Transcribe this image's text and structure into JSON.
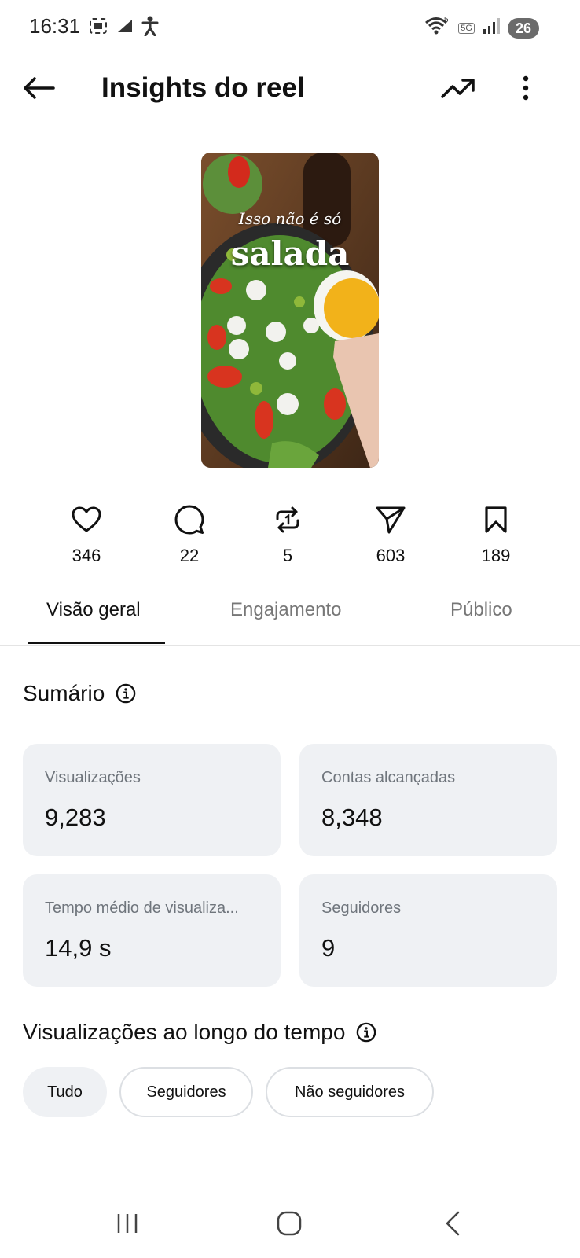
{
  "status_bar": {
    "time": "16:31",
    "battery": "26",
    "network": "5G",
    "wifi_badge": "5"
  },
  "header": {
    "title": "Insights do reel",
    "back_icon": "arrow-left-icon",
    "trend_icon": "trending-up-icon",
    "more_icon": "more-vertical-icon"
  },
  "thumbnail": {
    "caption_line1": "Isso não é só",
    "caption_line2": "salada"
  },
  "stats": [
    {
      "icon": "heart-icon",
      "value": "346"
    },
    {
      "icon": "comment-icon",
      "value": "22"
    },
    {
      "icon": "repost-icon",
      "value": "5"
    },
    {
      "icon": "share-icon",
      "value": "603"
    },
    {
      "icon": "bookmark-icon",
      "value": "189"
    }
  ],
  "tabs": [
    {
      "label": "Visão geral",
      "active": true
    },
    {
      "label": "Engajamento",
      "active": false
    },
    {
      "label": "Público",
      "active": false
    }
  ],
  "summary": {
    "title": "Sumário",
    "cards": [
      {
        "label": "Visualizações",
        "value": "9,283"
      },
      {
        "label": "Contas alcançadas",
        "value": "8,348"
      },
      {
        "label": "Tempo médio de visualiza...",
        "value": "14,9 s"
      },
      {
        "label": "Seguidores",
        "value": "9"
      }
    ]
  },
  "views_over_time": {
    "title": "Visualizações ao longo do tempo",
    "chips": [
      {
        "label": "Tudo",
        "selected": true
      },
      {
        "label": "Seguidores",
        "selected": false
      },
      {
        "label": "Não seguidores",
        "selected": false
      }
    ]
  },
  "colors": {
    "card_bg": "#eff1f4",
    "muted_text": "#6f757c",
    "primary_text": "#111111"
  }
}
